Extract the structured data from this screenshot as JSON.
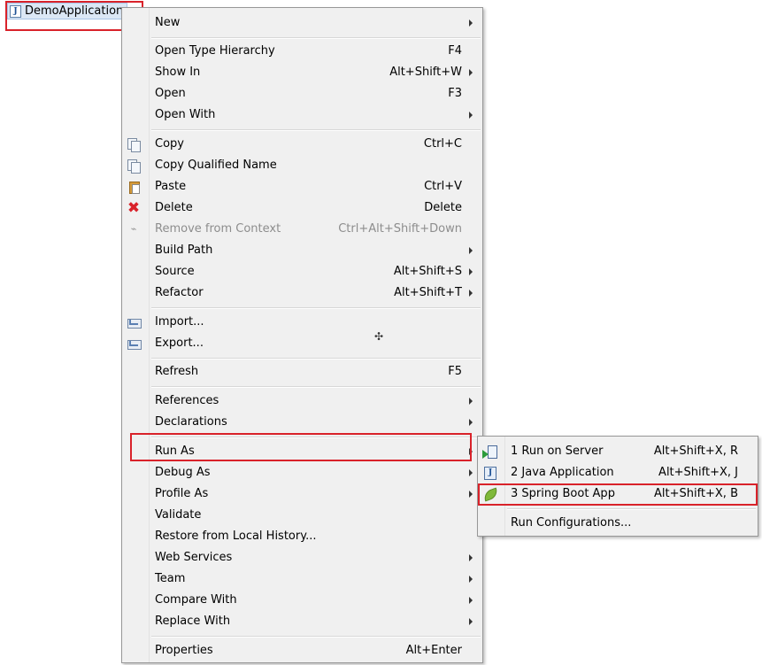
{
  "tree": {
    "node_label": "DemoApplication"
  },
  "context_menu": {
    "items": [
      {
        "label": "New",
        "shortcut": ""
      },
      {
        "label": "Open Type Hierarchy",
        "shortcut": "F4"
      },
      {
        "label": "Show In",
        "shortcut": "Alt+Shift+W"
      },
      {
        "label": "Open",
        "shortcut": "F3"
      },
      {
        "label": "Open With",
        "shortcut": ""
      },
      {
        "label": "Copy",
        "shortcut": "Ctrl+C"
      },
      {
        "label": "Copy Qualified Name",
        "shortcut": ""
      },
      {
        "label": "Paste",
        "shortcut": "Ctrl+V"
      },
      {
        "label": "Delete",
        "shortcut": "Delete"
      },
      {
        "label": "Remove from Context",
        "shortcut": "Ctrl+Alt+Shift+Down"
      },
      {
        "label": "Build Path",
        "shortcut": ""
      },
      {
        "label": "Source",
        "shortcut": "Alt+Shift+S"
      },
      {
        "label": "Refactor",
        "shortcut": "Alt+Shift+T"
      },
      {
        "label": "Import...",
        "shortcut": ""
      },
      {
        "label": "Export...",
        "shortcut": ""
      },
      {
        "label": "Refresh",
        "shortcut": "F5"
      },
      {
        "label": "References",
        "shortcut": ""
      },
      {
        "label": "Declarations",
        "shortcut": ""
      },
      {
        "label": "Run As",
        "shortcut": ""
      },
      {
        "label": "Debug As",
        "shortcut": ""
      },
      {
        "label": "Profile As",
        "shortcut": ""
      },
      {
        "label": "Validate",
        "shortcut": ""
      },
      {
        "label": "Restore from Local History...",
        "shortcut": ""
      },
      {
        "label": "Web Services",
        "shortcut": ""
      },
      {
        "label": "Team",
        "shortcut": ""
      },
      {
        "label": "Compare With",
        "shortcut": ""
      },
      {
        "label": "Replace With",
        "shortcut": ""
      },
      {
        "label": "Properties",
        "shortcut": "Alt+Enter"
      }
    ]
  },
  "run_as_submenu": {
    "items": [
      {
        "label": "1 Run on Server",
        "shortcut": "Alt+Shift+X, R"
      },
      {
        "label": "2 Java Application",
        "shortcut": "Alt+Shift+X, J"
      },
      {
        "label": "3 Spring Boot App",
        "shortcut": "Alt+Shift+X, B"
      },
      {
        "label": "Run Configurations...",
        "shortcut": ""
      }
    ]
  },
  "colors": {
    "highlight_box": "#d9222a",
    "menu_background": "#f0f0f0",
    "disabled_text": "#8d8d8d"
  }
}
